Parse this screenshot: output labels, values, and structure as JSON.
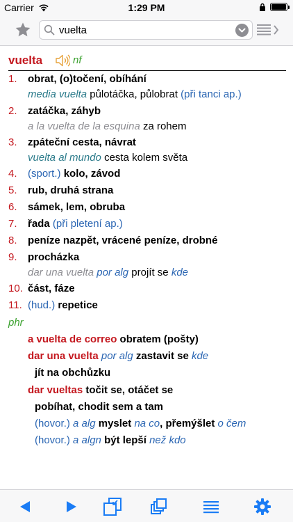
{
  "status_bar": {
    "carrier": "Carrier",
    "time": "1:29 PM",
    "battery_level": 1.0
  },
  "nav": {
    "search_value": "vuelta",
    "icons": [
      "star-icon",
      "search-icon",
      "chevron-down-icon",
      "list-arrow-icon"
    ]
  },
  "entry": {
    "headword": "vuelta",
    "pos": "nf",
    "s1": {
      "num": "1.",
      "t": "obrat, (o)točení, obíhání",
      "ex": "media vuelta",
      "tr": " půlotáčka, půlobrat ",
      "note": "(při tanci ap.)"
    },
    "s2": {
      "num": "2.",
      "t": "zatáčka, záhyb",
      "ex": "a la vuelta de la esquina",
      "tr": " za rohem"
    },
    "s3": {
      "num": "3.",
      "t": "zpáteční cesta, návrat",
      "ex": "vuelta al mundo",
      "tr": " cesta kolem světa"
    },
    "s4": {
      "num": "4.",
      "label": "(sport.) ",
      "t": "kolo, závod"
    },
    "s5": {
      "num": "5.",
      "t": "rub, druhá strana"
    },
    "s6": {
      "num": "6.",
      "t": "sámek, lem, obruba"
    },
    "s7": {
      "num": "7.",
      "t": "řada",
      "note": " (při pletení ap.)"
    },
    "s8": {
      "num": "8.",
      "t": "peníze nazpět, vrácené peníze, drobné"
    },
    "s9": {
      "num": "9.",
      "t": "procházka",
      "ex": "dar una vuelta",
      "ex2": " por alg",
      "tr": " projít se ",
      "ex3": "kde"
    },
    "s10": {
      "num": "10.",
      "t": "část, fáze"
    },
    "s11": {
      "num": "11.",
      "label": "(hud.) ",
      "t": "repetice"
    },
    "phr_label": "phr",
    "p1": {
      "es": "a vuelta de correo",
      "tr": " obratem (pošty)"
    },
    "p2": {
      "es": "dar una vuelta",
      "mid": " por alg",
      "tr": " zastavit se ",
      "end": "kde"
    },
    "p2b": {
      "tr": "jít na obchůzku"
    },
    "p3": {
      "es": "dar vueltas",
      "tr": " točit se, otáčet se"
    },
    "p3b": {
      "tr": "pobíhat, chodit sem a tam"
    },
    "p3c": {
      "label": "(hovor.) ",
      "es": "a alg",
      "tr1": " myslet ",
      "m1": "na co",
      "tr2": ", přemýšlet ",
      "m2": "o čem"
    },
    "p3d": {
      "label": "(hovor.) ",
      "es": "a algn",
      "tr1": " být lepší ",
      "m1": "než kdo"
    }
  },
  "tabbar": {
    "icons": [
      "back-icon",
      "forward-icon",
      "copy-window-icon",
      "stack-icon",
      "list-icon",
      "gear-icon"
    ]
  },
  "colors": {
    "accent": "#1a7cf5",
    "headword": "#c4181f",
    "pos": "#3aa12e",
    "note": "#2b66b3",
    "example": "#2a7a8a",
    "gray_example": "#8e8e93"
  }
}
